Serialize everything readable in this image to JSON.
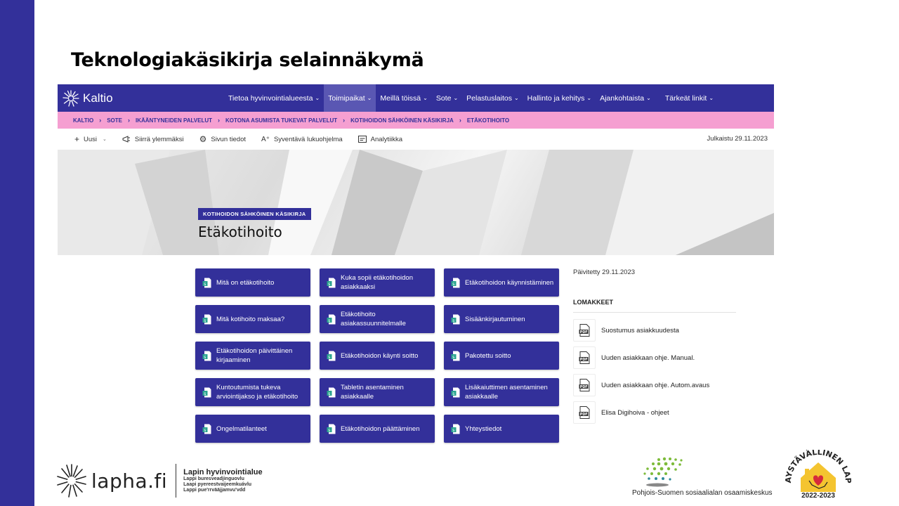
{
  "slide": {
    "title": "Teknologiakäsikirja selainnäkymä"
  },
  "nav": {
    "brand": "Kaltio",
    "items": [
      {
        "label": "Tietoa hyvinvointialueesta",
        "chevron": true,
        "active": false
      },
      {
        "label": "Toimipaikat",
        "chevron": true,
        "active": true
      },
      {
        "label": "Meillä töissä",
        "chevron": true,
        "active": false
      },
      {
        "label": "Sote",
        "chevron": true,
        "active": false
      },
      {
        "label": "Pelastuslaitos",
        "chevron": true,
        "active": false
      },
      {
        "label": "Hallinto ja kehitys",
        "chevron": true,
        "active": false
      },
      {
        "label": "Ajankohtaista",
        "chevron": true,
        "active": false
      },
      {
        "label": "Tärkeät linkit",
        "chevron": true,
        "active": false
      }
    ]
  },
  "breadcrumb": [
    "KALTIO",
    "SOTE",
    "IKÄÄNTYNEIDEN PALVELUT",
    "KOTONA ASUMISTA TUKEVAT PALVELUT",
    "KOTIHOIDON SÄHKÖINEN KÄSIKIRJA",
    "ETÄKOTIHOITO"
  ],
  "commandbar": {
    "items": [
      {
        "icon": "plus-icon",
        "label": "Uusi",
        "chevron": true
      },
      {
        "icon": "promote-icon",
        "label": "Siirrä ylemmäksi"
      },
      {
        "icon": "gear-icon",
        "label": "Sivun tiedot"
      },
      {
        "icon": "immersive-reader-icon",
        "label": "Syventävä lukuohjelma"
      },
      {
        "icon": "analytics-icon",
        "label": "Analytiikka"
      }
    ],
    "published": "Julkaistu 29.11.2023"
  },
  "hero": {
    "tag": "KOTIHOIDON SÄHKÖINEN KÄSIKIRJA",
    "title": "Etäkotihoito"
  },
  "tiles": [
    [
      "Mitä on etäkotihoito",
      "Kuka sopii etäkotihoidon asiakkaaksi",
      "Etäkotihoidon käynnistäminen"
    ],
    [
      "Mitä kotihoito maksaa?",
      "Etäkotihoito asiakassuunnitelmalle",
      "Sisäänkirjautuminen"
    ],
    [
      "Etäkotihoidon päivittäinen kirjaaminen",
      "Etäkotihoidon käynti soitto",
      "Pakotettu soitto"
    ],
    [
      "Kuntoutumista tukeva arviointijakso ja etäkotihoito",
      "Tabletin asentaminen asiakkaalle",
      "Lisäkaiuttimen asentaminen asiakkaalle"
    ],
    [
      "Ongelmatilanteet",
      "Etäkotihoidon päättäminen",
      "Yhteystiedot"
    ]
  ],
  "sidebar": {
    "updated": "Päivitetty 29.11.2023",
    "forms_title": "LOMAKKEET",
    "forms": [
      "Suostumus asiakkuudesta",
      "Uuden asiakkaan ohje. Manual.",
      "Uuden asiakkaan ohje. Autom.avaus",
      "Elisa Digihoiva - ohjeet"
    ]
  },
  "footer": {
    "lapha_word": "lapha.fi",
    "lapha_title": "Lapin hyvinvointialue",
    "lapha_lines": [
      "Lappi buresveadjinguovlu",
      "Laapi pyereestvaijeemkuávlu",
      "Lappi pue'rrvääjjamvu'vdd"
    ],
    "pss": "Pohjois-Suomen sosiaalialan osaamiskeskus",
    "ika_text": "IKÄYSTÄVÄLLINEN LAPPI",
    "ika_year": "2022-2023"
  },
  "colors": {
    "brand": "#33309a",
    "breadcrumb_bg": "#f59fd1",
    "active_nav": "#5a57b3"
  }
}
